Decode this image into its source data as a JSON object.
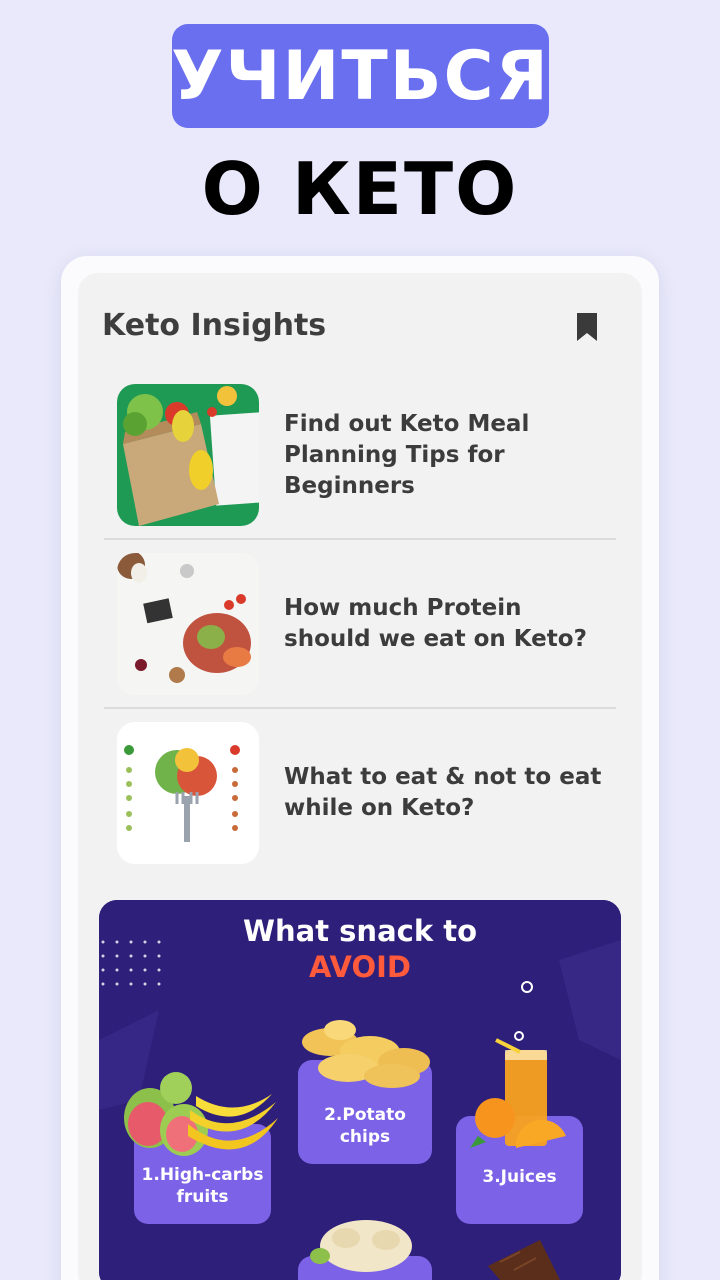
{
  "hero": {
    "line1": "УЧИТЬСЯ",
    "line2": "О КЕТО"
  },
  "insights": {
    "title": "Keto Insights",
    "bookmark_icon": "bookmark-icon",
    "articles": [
      {
        "title": "Find out Keto Meal Planning Tips for Beginners",
        "image": "grocery-bag-vegetables"
      },
      {
        "title": "How much Protein should we eat on Keto?",
        "image": "keto-protein-foods"
      },
      {
        "title": "What to eat & not to eat while on Keto?",
        "image": "food-fork-chart"
      }
    ]
  },
  "banner": {
    "title_line1": "What snack to",
    "title_line2": "AVOID",
    "items": [
      {
        "label": "1.High-carbs fruits"
      },
      {
        "label": "2.Potato chips"
      },
      {
        "label": "3.Juices"
      }
    ]
  },
  "colors": {
    "background": "#e9e9fb",
    "accent": "#6a6ff0",
    "banner_bg": "#2e1f7a",
    "banner_card": "#7b62e6",
    "avoid": "#ff5a3c"
  }
}
